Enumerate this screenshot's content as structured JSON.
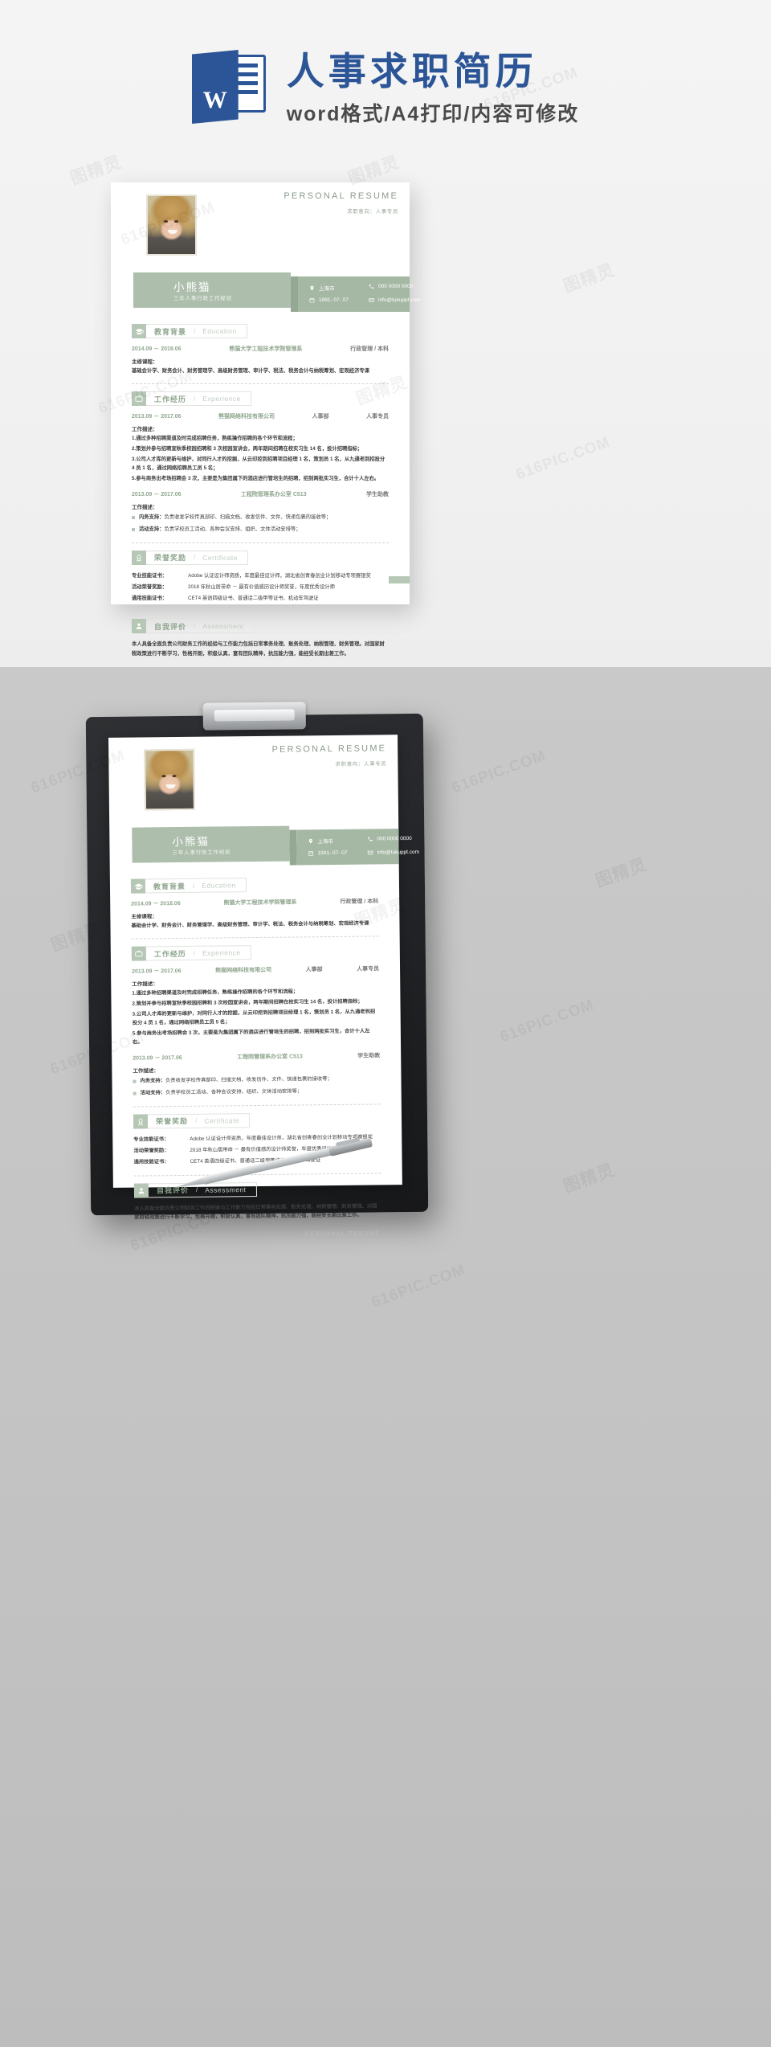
{
  "banner": {
    "logo_letter": "W",
    "title": "人事求职简历",
    "subtitle": "word格式/A4打印/内容可修改"
  },
  "resume": {
    "header": {
      "personal_title": "PERSONAL RESUME",
      "objective": "求职意向：人事专员"
    },
    "name": "小熊猫",
    "name_sub": "三年人事行政工作经验",
    "contacts": [
      {
        "icon": "location-icon",
        "text": "上海市"
      },
      {
        "icon": "calendar-icon",
        "text": "1991- 07- 07"
      },
      {
        "icon": "phone-icon",
        "text": "000 0000 0000"
      },
      {
        "icon": "mail-icon",
        "text": "info@tukuppt.com"
      }
    ],
    "sections": {
      "education": {
        "icon": "graduation-cap-icon",
        "cn": "教育背景",
        "slash": "/",
        "en": "Education",
        "date": "2014.09 － 2018.06",
        "school": "熊猫大学工程技术学院管理系",
        "right": "行政管理 / 本科",
        "courses_label": "主修课程：",
        "courses": "基础会计学、财务会计、财务管理学、高级财务管理、审计学、税法、税务会计与纳税筹划、宏观经济专课"
      },
      "experience": {
        "icon": "briefcase-icon",
        "cn": "工作经历",
        "slash": "/",
        "en": "Experience",
        "jobs": [
          {
            "date": "2013.09 － 2017.06",
            "company": "熊猫网络科技有限公司",
            "dept": "人事部",
            "role": "人事专员",
            "desc_label": "工作描述：",
            "items": [
              "1.通过多种招聘渠道及时完成招聘任务，熟练操作招聘的各个环节和流程；",
              "2.策划并参与招聘宣秋季校园招聘和 3 次校园宣讲会，两年期间招聘在校实习生 14 名，投计招聘指标；",
              "3.公司人才库的更新与维护，对同行人才的挖掘，从云印挖到招聘项目经理 1 名，策划员 1 名，从九通老到招投分 4 员 1 名，通过网络招聘员工员 5 名；",
              "5.参与商务出考场招聘会 3 次，主要是为集团属下的酒店进行管培生的招聘，招到两批实习生，合计十人左右。"
            ]
          },
          {
            "date": "2013.09 － 2017.06",
            "company": "工程院管理系办公室 C513",
            "dept": "",
            "role": "学生助教",
            "desc_label": "工作描述：",
            "bullets": [
              {
                "k": "内务支持：",
                "v": "负责收发学校传真部印、扫描文档、收发信件、文件、快递包裹的接收等；"
              },
              {
                "k": "活动支持：",
                "v": "负责学校员工活动、各种会议安排、组织、文体活动安排等；"
              }
            ]
          }
        ]
      },
      "certificate": {
        "icon": "award-icon",
        "cn": "荣誉奖励",
        "slash": "/",
        "en": "Certificate",
        "rows": [
          {
            "k": "专业技能证书：",
            "v": "Adobe 认证设计师资质，年度最佳设计师，湖北省创青春创业计划移动专项赛银奖"
          },
          {
            "k": "活动荣誉奖励：",
            "v": "2018 年秋山居带命 － 最有价值感历设计师奖誉，年度优秀设计师"
          },
          {
            "k": "通用技能证书：",
            "v": "CET4 英语四级证书、普通话二级甲等证书、机动车驾驶证"
          }
        ]
      },
      "assessment": {
        "icon": "person-icon",
        "cn": "自我评价",
        "slash": "/",
        "en": "Assessment",
        "text": "本人具备全面负责公司财务工作的经验与工作能力包括日常事务处理、账务处理、纳税管理、财务管理。对国家财税政策进行不断学习，性格开朗，积极认真，富有团队精神，抗压能力强，能经受长期出差工作。"
      }
    },
    "footer_mark": "PERSONAL RESUME"
  },
  "watermarks": {
    "text_en": "616PIC.COM",
    "text_cn": "图精灵"
  }
}
